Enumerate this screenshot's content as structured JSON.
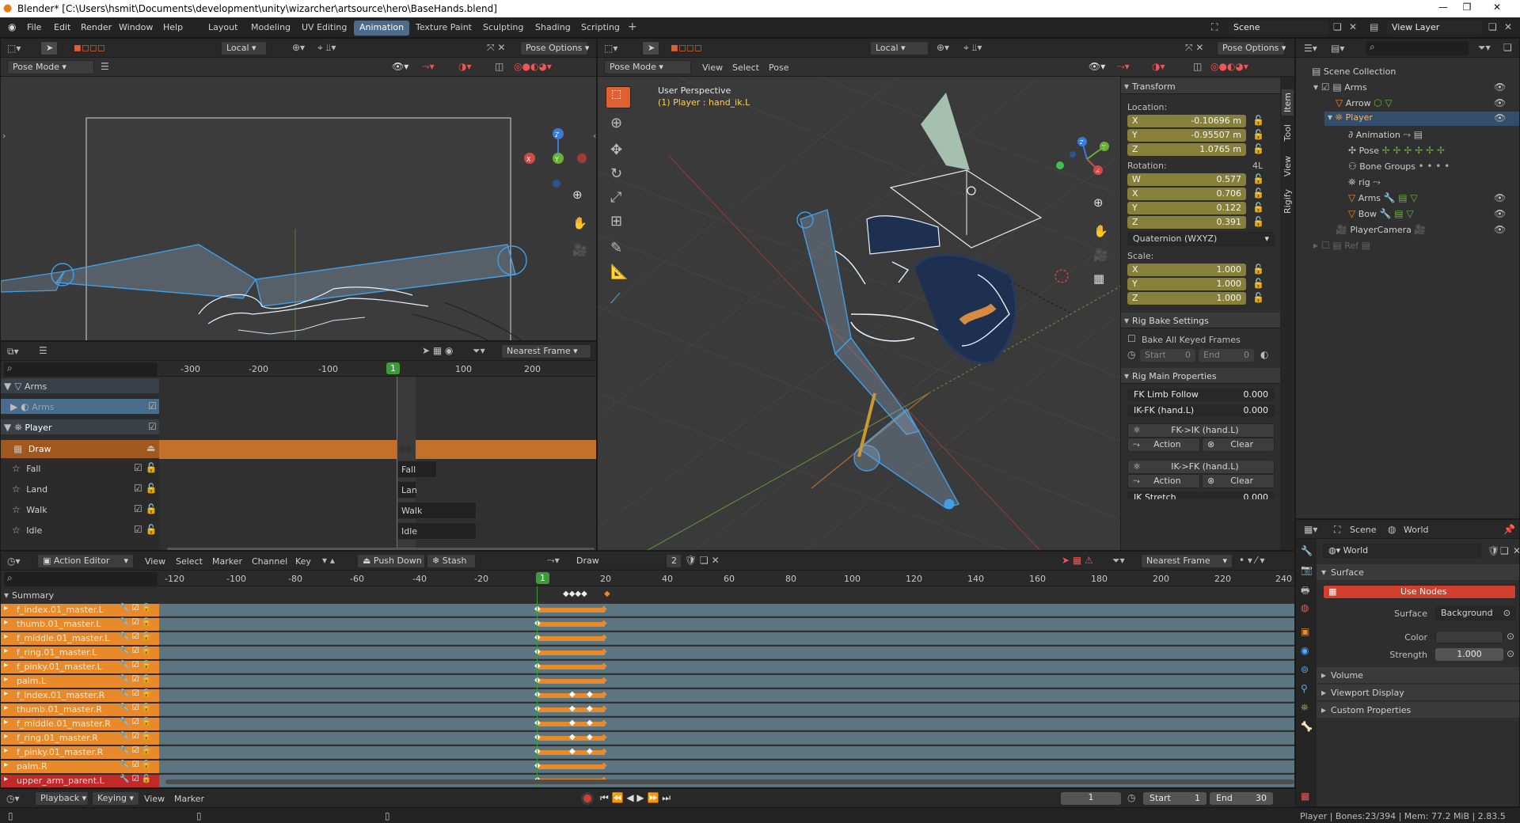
{
  "window": {
    "title": "Blender* [C:\\Users\\hsmit\\Documents\\development\\unity\\wizarcher\\artsource\\hero\\BaseHands.blend]"
  },
  "menu": [
    "File",
    "Edit",
    "Render",
    "Window",
    "Help"
  ],
  "workspaces": [
    "Layout",
    "Modeling",
    "UV Editing",
    "Animation",
    "Texture Paint",
    "Sculpting",
    "Shading",
    "Scripting"
  ],
  "active_workspace": "Animation",
  "scene": {
    "name": "Scene",
    "view_layer": "View Layer"
  },
  "left_viewport": {
    "mode": "Pose Mode",
    "transform_space": "Local",
    "pose_options": "Pose Options"
  },
  "main_viewport": {
    "mode": "Pose Mode",
    "menus": [
      "View",
      "Select",
      "Pose"
    ],
    "transform_space": "Local",
    "pose_options": "Pose Options",
    "overlay_title": "User Perspective",
    "overlay_subtitle": "(1) Player : hand_ik.L",
    "side_tabs": [
      "Item",
      "Tool",
      "View",
      "Rigify"
    ]
  },
  "nla": {
    "snap": "Nearest Frame",
    "ticks": [
      "-300",
      "-200",
      "-100",
      "100",
      "200"
    ],
    "current_frame": "1",
    "tracks": [
      {
        "name": "Arms",
        "type": "object"
      },
      {
        "name": "Arms",
        "type": "action"
      },
      {
        "name": "Player",
        "type": "object"
      },
      {
        "name": "Draw",
        "type": "action-active"
      },
      {
        "name": "Fall",
        "type": "track"
      },
      {
        "name": "Land",
        "type": "track"
      },
      {
        "name": "Walk",
        "type": "track"
      },
      {
        "name": "Idle",
        "type": "track"
      }
    ],
    "strips": [
      "Fall",
      "Lan",
      "Walk",
      "Idle"
    ]
  },
  "properties_panel": {
    "transform": {
      "title": "Transform",
      "location_label": "Location:",
      "location": [
        {
          "axis": "X",
          "value": "-0.10696 m"
        },
        {
          "axis": "Y",
          "value": "-0.95507 m"
        },
        {
          "axis": "Z",
          "value": "1.0765 m"
        }
      ],
      "rotation_label": "Rotation:",
      "rotation_mode_tag": "4L",
      "rotation": [
        {
          "axis": "W",
          "value": "0.577"
        },
        {
          "axis": "X",
          "value": "0.706"
        },
        {
          "axis": "Y",
          "value": "0.122"
        },
        {
          "axis": "Z",
          "value": "0.391"
        }
      ],
      "rotation_mode": "Quaternion (WXYZ)",
      "scale_label": "Scale:",
      "scale": [
        {
          "axis": "X",
          "value": "1.000"
        },
        {
          "axis": "Y",
          "value": "1.000"
        },
        {
          "axis": "Z",
          "value": "1.000"
        }
      ]
    },
    "rig_bake": {
      "title": "Rig Bake Settings",
      "bake_all": "Bake All Keyed Frames",
      "start_label": "Start",
      "start_value": "0",
      "end_label": "End",
      "end_value": "0"
    },
    "rig_main": {
      "title": "Rig Main Properties",
      "props": [
        {
          "label": "FK Limb Follow",
          "value": "0.000"
        },
        {
          "label": "IK-FK (hand.L)",
          "value": "0.000"
        }
      ],
      "fk_ik": "FK->IK (hand.L)",
      "ik_fk": "IK->FK (hand.L)",
      "action": "Action",
      "clear": "Clear",
      "ik_stretch": "IK Stretch",
      "ik_stretch_value": "0.000"
    }
  },
  "outliner": {
    "root": "Scene Collection",
    "items": [
      {
        "label": "Arms",
        "depth": 1,
        "kind": "collection"
      },
      {
        "label": "Arrow",
        "depth": 2,
        "kind": "mesh"
      },
      {
        "label": "Player",
        "depth": 2,
        "kind": "armature",
        "highlight": true
      },
      {
        "label": "Animation",
        "depth": 3,
        "kind": "anim"
      },
      {
        "label": "Pose",
        "depth": 3,
        "kind": "pose"
      },
      {
        "label": "Bone Groups",
        "depth": 3,
        "kind": "group"
      },
      {
        "label": "rig",
        "depth": 3,
        "kind": "rig"
      },
      {
        "label": "Arms",
        "depth": 3,
        "kind": "mesh"
      },
      {
        "label": "Bow",
        "depth": 3,
        "kind": "mesh"
      },
      {
        "label": "PlayerCamera",
        "depth": 2,
        "kind": "camera"
      },
      {
        "label": "Ref",
        "depth": 1,
        "kind": "collection-dim"
      }
    ]
  },
  "world_props": {
    "tabs": [
      "Scene",
      "World"
    ],
    "world_name": "World",
    "surface_section": "Surface",
    "use_nodes": "Use Nodes",
    "surface_label": "Surface",
    "surface_value": "Background",
    "color_label": "Color",
    "strength_label": "Strength",
    "strength_value": "1.000",
    "sections": [
      "Volume",
      "Viewport Display",
      "Custom Properties"
    ]
  },
  "action_editor": {
    "mode": "Action Editor",
    "menus": [
      "View",
      "Select",
      "Marker",
      "Channel",
      "Key"
    ],
    "push_down": "Push Down",
    "stash": "Stash",
    "action_name": "Draw",
    "users": "2",
    "snap": "Nearest Frame",
    "ticks": [
      "-120",
      "-100",
      "-80",
      "-60",
      "-40",
      "-20",
      "20",
      "40",
      "60",
      "80",
      "100",
      "120",
      "140",
      "160",
      "180",
      "200",
      "220",
      "240"
    ],
    "current_frame": "1",
    "summary": "Summary",
    "channels": [
      "f_index.01_master.L",
      "thumb.01_master.L",
      "f_middle.01_master.L",
      "f_ring.01_master.L",
      "f_pinky.01_master.L",
      "palm.L",
      "f_index.01_master.R",
      "thumb.01_master.R",
      "f_middle.01_master.R",
      "f_ring.01_master.R",
      "f_pinky.01_master.R",
      "palm.R",
      "upper_arm_parent.L"
    ]
  },
  "timeline": {
    "menus": [
      "Playback",
      "Keying",
      "View",
      "Marker"
    ],
    "current_frame": "1",
    "start_label": "Start",
    "start": "1",
    "end_label": "End",
    "end": "30"
  },
  "status_bar": {
    "text": "Player | Bones:23/394 | Mem: 77.2 MiB | 2.83.5"
  },
  "colors": {
    "accent_blue": "#4f6b8c",
    "active_orange": "#e8892a",
    "selected_field": "#86803b",
    "keyframe_bg": "#5b7680"
  }
}
